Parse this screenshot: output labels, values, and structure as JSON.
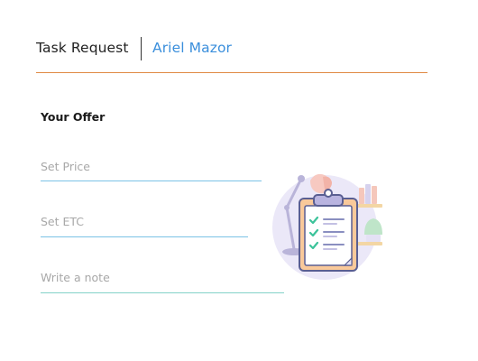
{
  "header": {
    "title": "Task Request",
    "assignee": "Ariel Mazor",
    "rule_color": "#e08a44"
  },
  "offer": {
    "section_title": "Your Offer",
    "price_placeholder": "Set Price",
    "etc_placeholder": "Set ETC",
    "note_placeholder": "Write a note"
  },
  "illustration": {
    "icon": "clipboard-checklist-illustration",
    "accent_colors": [
      "#e9e6f8",
      "#f8cfa4",
      "#4fc8a0",
      "#5a5f92"
    ]
  }
}
